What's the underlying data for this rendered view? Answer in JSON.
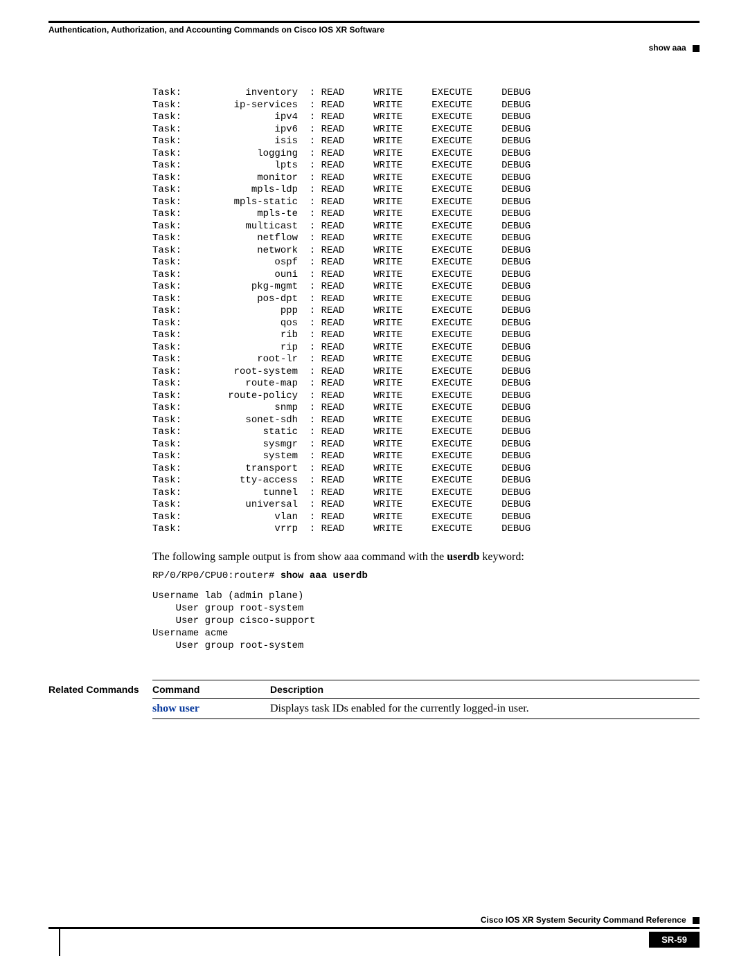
{
  "header": {
    "chapter": "Authentication, Authorization, and Accounting Commands on Cisco IOS XR Software",
    "section": "show aaa"
  },
  "task_block": {
    "prefix": "Task:",
    "columns": [
      "READ",
      "WRITE",
      "EXECUTE",
      "DEBUG"
    ],
    "rows": [
      "inventory",
      "ip-services",
      "ipv4",
      "ipv6",
      "isis",
      "logging",
      "lpts",
      "monitor",
      "mpls-ldp",
      "mpls-static",
      "mpls-te",
      "multicast",
      "netflow",
      "network",
      "ospf",
      "ouni",
      "pkg-mgmt",
      "pos-dpt",
      "ppp",
      "qos",
      "rib",
      "rip",
      "root-lr",
      "root-system",
      "route-map",
      "route-policy",
      "snmp",
      "sonet-sdh",
      "static",
      "sysmgr",
      "system",
      "transport",
      "tty-access",
      "tunnel",
      "universal",
      "vlan",
      "vrrp"
    ]
  },
  "intro": {
    "pre": "The following sample output is from show aaa command with the ",
    "bold": "userdb",
    "post": " keyword:"
  },
  "cmdline": {
    "prompt": "RP/0/RP0/CPU0:router# ",
    "cmd": "show aaa userdb"
  },
  "output": "Username lab (admin plane)\n    User group root-system\n    User group cisco-support\nUsername acme\n    User group root-system",
  "related": {
    "label": "Related Commands",
    "headers": [
      "Command",
      "Description"
    ],
    "rows": [
      {
        "cmd": "show user",
        "desc": "Displays task IDs enabled for the currently logged-in user."
      }
    ]
  },
  "footer": {
    "title": "Cisco IOS XR System Security Command Reference",
    "page": "SR-59"
  }
}
